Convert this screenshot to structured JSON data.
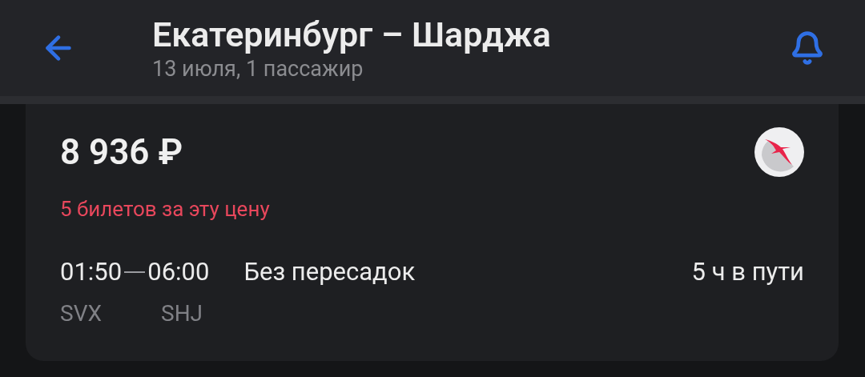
{
  "header": {
    "title": "Екатеринбург – Шарджа",
    "subtitle": "13 июля, 1 пассажир"
  },
  "ticket": {
    "price": "8 936 ₽",
    "availability": "5 билетов за эту цену",
    "departure_time": "01:50",
    "arrival_time": "06:00",
    "stops": "Без пересадок",
    "duration": "5 ч в пути",
    "departure_code": "SVX",
    "arrival_code": "SHJ"
  }
}
